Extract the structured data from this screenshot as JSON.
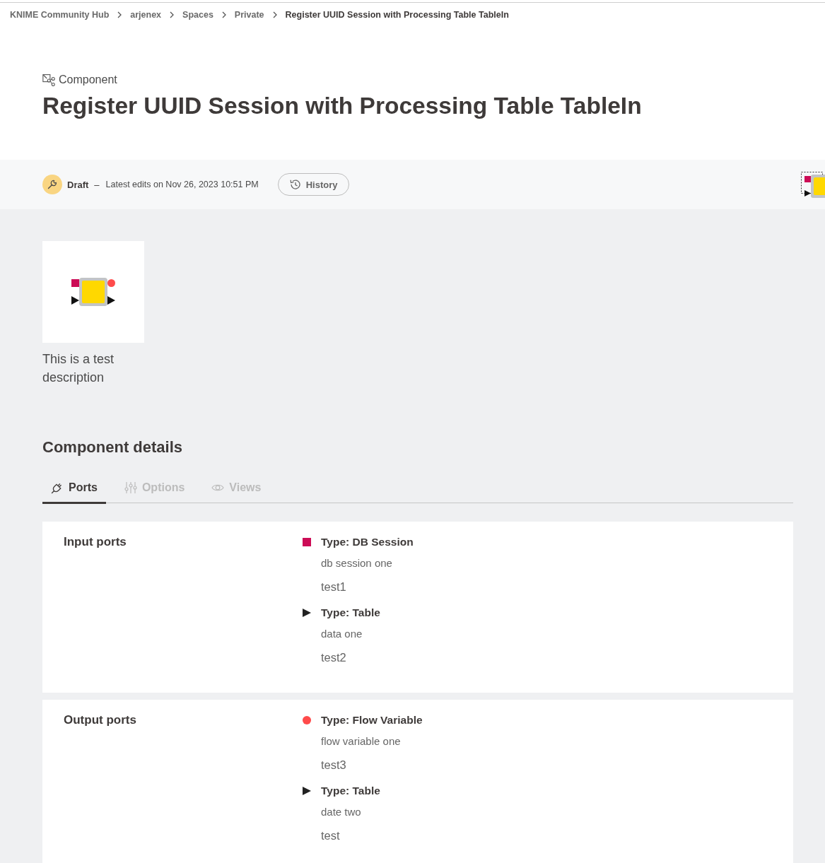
{
  "breadcrumb": [
    {
      "label": "KNIME Community Hub"
    },
    {
      "label": "arjenex"
    },
    {
      "label": "Spaces"
    },
    {
      "label": "Private"
    },
    {
      "label": "Register UUID Session with Processing Table TableIn"
    }
  ],
  "header": {
    "type_label": "Component",
    "title": "Register UUID Session with Processing Table TableIn"
  },
  "status_bar": {
    "state": "Draft",
    "dash": "–",
    "edited": "Latest edits on Nov 26, 2023 10:51 PM",
    "history_button": "History"
  },
  "overview": {
    "description": "This is a test description"
  },
  "details": {
    "title": "Component details",
    "tabs": [
      {
        "kind": "ports",
        "label": "Ports",
        "selected": true
      },
      {
        "kind": "options",
        "label": "Options",
        "selected": false
      },
      {
        "kind": "views",
        "label": "Views",
        "selected": false
      }
    ],
    "port_groups": [
      {
        "title": "Input ports",
        "ports": [
          {
            "kind": "square",
            "color": "#cc0c56",
            "type": "Type: DB Session",
            "name": "db session one",
            "description": "test1"
          },
          {
            "kind": "triangle",
            "color": "#222222",
            "type": "Type: Table",
            "name": "data one",
            "description": "test2"
          }
        ]
      },
      {
        "title": "Output ports",
        "ports": [
          {
            "kind": "circle",
            "color": "#ff4b4b",
            "type": "Type: Flow Variable",
            "name": "flow variable one",
            "description": "test3"
          },
          {
            "kind": "triangle",
            "color": "#222222",
            "type": "Type: Table",
            "name": "date two",
            "description": "test"
          }
        ]
      }
    ]
  }
}
